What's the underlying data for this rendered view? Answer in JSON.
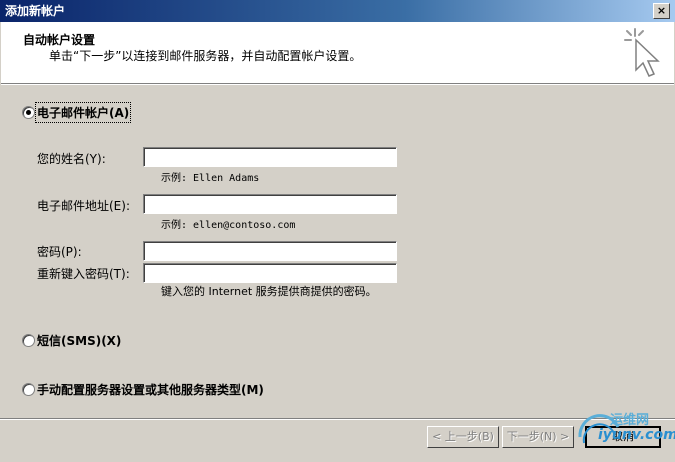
{
  "window": {
    "title": "添加新帐户",
    "close_glyph": "×"
  },
  "banner": {
    "title": "自动帐户设置",
    "description": "单击“下一步”以连接到邮件服务器，并自动配置帐户设置。",
    "icon": "wizard-cursor-icon"
  },
  "options": {
    "email": {
      "label": "电子邮件帐户(A)",
      "selected": true
    },
    "sms": {
      "label": "短信(SMS)(X)",
      "selected": false
    },
    "manual": {
      "label": "手动配置服务器设置或其他服务器类型(M)",
      "selected": false
    }
  },
  "fields": {
    "name": {
      "label": "您的姓名(Y):",
      "value": "",
      "hint": "示例: Ellen Adams"
    },
    "email": {
      "label": "电子邮件地址(E):",
      "value": "",
      "hint": "示例: ellen@contoso.com"
    },
    "password": {
      "label": "密码(P):",
      "value": ""
    },
    "password_confirm": {
      "label": "重新键入密码(T):",
      "value": "",
      "hint": "键入您的 Internet 服务提供商提供的密码。"
    }
  },
  "buttons": {
    "back": "< 上一步(B)",
    "next": "下一步(N) >",
    "cancel": "取消"
  },
  "watermark": {
    "line1": "运维网",
    "line2": "iyunv.com"
  }
}
